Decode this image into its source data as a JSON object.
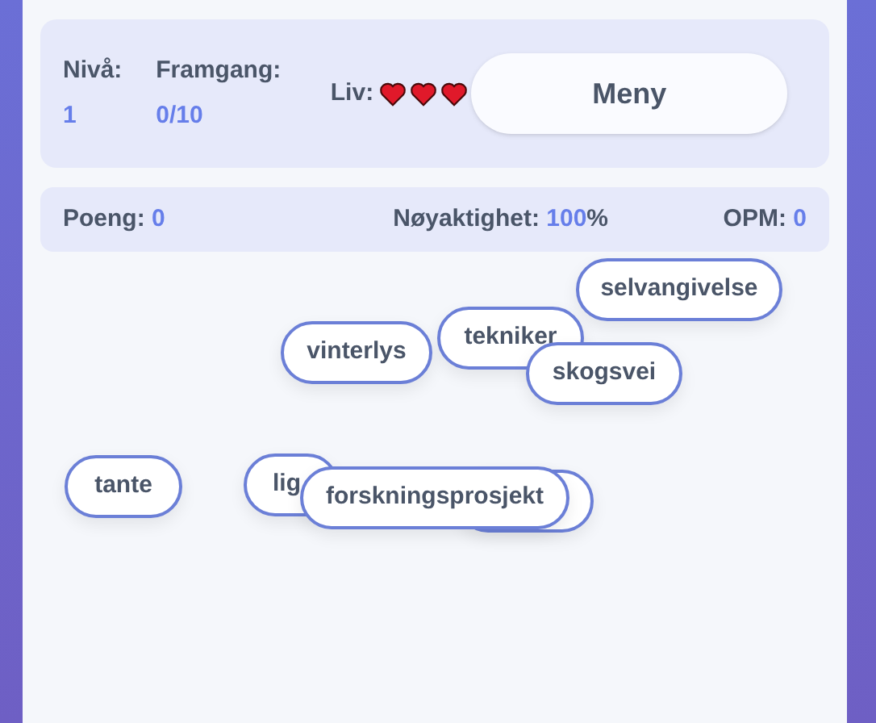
{
  "stats": {
    "level": {
      "label": "Nivå:",
      "value": "1"
    },
    "progress": {
      "label": "Framgang:",
      "value": "0/10"
    },
    "lives": {
      "label": "Liv:",
      "stars": 3
    },
    "menu_button": "Meny"
  },
  "score_bar": {
    "score": {
      "label": "Poeng:",
      "value": "0"
    },
    "accuracy": {
      "label": "Nøyaktighet:",
      "value": "100",
      "unit": "%"
    },
    "wpm": {
      "label": "OPM:",
      "value": "0"
    }
  },
  "words": [
    {
      "kind": "word",
      "text": "selvangivelse"
    },
    {
      "kind": "word",
      "text": "tekniker"
    },
    {
      "kind": "word",
      "text": "vinterlys"
    },
    {
      "kind": "word",
      "text": "skogsvei"
    },
    {
      "kind": "word",
      "text": "tante"
    },
    {
      "kind": "word",
      "text": "lig"
    },
    {
      "kind": "covered"
    },
    {
      "kind": "word",
      "text": "forskningsprosjekt"
    }
  ]
}
